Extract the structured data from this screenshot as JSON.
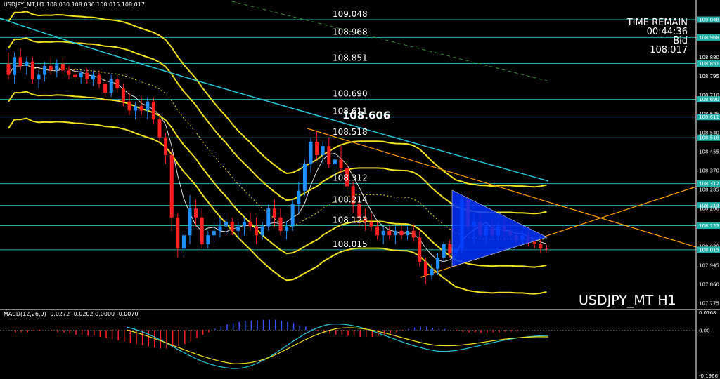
{
  "header": {
    "symbol_info": "USDJPY_MT,H1  108.030 108.036 108.015 108.017",
    "macd_info": "MACD(12,26,9) -0.0272 -0.0202 0.0000 -0.0070"
  },
  "time_remain": {
    "title": "TIME REMAIN",
    "time": "00:44:36",
    "bid_label": "Bid",
    "bid_value": "108.017"
  },
  "watermark": "USDJPY_MT H1",
  "colors": {
    "background": "#000000",
    "bull": "#1e90ff",
    "bear": "#ff2020",
    "level_line": "#20b2aa",
    "bollinger": "#f0e020",
    "trendline": "#ff9900",
    "ma_cyan": "#26c6da",
    "macd_hist_pos": "#3355ff",
    "macd_hist_neg": "#ff2020",
    "triangle_fill": "#0033ff"
  },
  "chart_data": {
    "type": "candlestick",
    "y_axis_ticks": [
      "109.048",
      "108.968",
      "108.880",
      "108.851",
      "108.795",
      "108.710",
      "108.690",
      "108.625",
      "108.611",
      "108.540",
      "108.518",
      "108.455",
      "108.370",
      "108.312",
      "108.285",
      "108.214",
      "108.200",
      "108.123",
      "108.030",
      "108.015",
      "107.945",
      "107.860",
      "107.775"
    ],
    "highlighted_ticks": [
      "109.048",
      "108.968",
      "108.851",
      "108.690",
      "108.611",
      "108.518",
      "108.312",
      "108.214",
      "108.123",
      "108.015"
    ],
    "levels": [
      {
        "label": "109.048",
        "value": 109.048
      },
      {
        "label": "108.968",
        "value": 108.968
      },
      {
        "label": "108.851",
        "value": 108.851
      },
      {
        "label": "108.690",
        "value": 108.69
      },
      {
        "label": "108.611",
        "value": 108.611
      },
      {
        "label": "108.518",
        "value": 108.518
      },
      {
        "label": "108.312",
        "value": 108.312
      },
      {
        "label": "108.214",
        "value": 108.214
      },
      {
        "label": "108.123",
        "value": 108.123
      },
      {
        "label": "108.015",
        "value": 108.015
      }
    ],
    "marked_price": {
      "label": "108.606",
      "value": 108.606
    },
    "price_range": [
      107.74,
      109.11
    ],
    "candles": [
      [
        108.85,
        108.9,
        108.78,
        108.8
      ],
      [
        108.8,
        108.9,
        108.76,
        108.88
      ],
      [
        108.88,
        108.92,
        108.82,
        108.84
      ],
      [
        108.84,
        108.88,
        108.8,
        108.86
      ],
      [
        108.86,
        108.88,
        108.76,
        108.78
      ],
      [
        108.78,
        108.82,
        108.74,
        108.8
      ],
      [
        108.8,
        108.86,
        108.77,
        108.84
      ],
      [
        108.84,
        108.88,
        108.8,
        108.82
      ],
      [
        108.82,
        108.87,
        108.79,
        108.85
      ],
      [
        108.85,
        108.88,
        108.8,
        108.82
      ],
      [
        108.82,
        108.84,
        108.78,
        108.8
      ],
      [
        108.8,
        108.83,
        108.77,
        108.79
      ],
      [
        108.79,
        108.82,
        108.76,
        108.81
      ],
      [
        108.81,
        108.83,
        108.76,
        108.78
      ],
      [
        108.78,
        108.82,
        108.75,
        108.8
      ],
      [
        108.8,
        108.82,
        108.74,
        108.76
      ],
      [
        108.76,
        108.78,
        108.7,
        108.72
      ],
      [
        108.72,
        108.8,
        108.7,
        108.78
      ],
      [
        108.78,
        108.8,
        108.72,
        108.74
      ],
      [
        108.74,
        108.76,
        108.66,
        108.68
      ],
      [
        108.68,
        108.72,
        108.62,
        108.64
      ],
      [
        108.64,
        108.68,
        108.6,
        108.66
      ],
      [
        108.66,
        108.7,
        108.62,
        108.64
      ],
      [
        108.64,
        108.7,
        108.6,
        108.68
      ],
      [
        108.68,
        108.7,
        108.58,
        108.6
      ],
      [
        108.6,
        108.62,
        108.5,
        108.52
      ],
      [
        108.52,
        108.54,
        108.4,
        108.44
      ],
      [
        108.44,
        108.46,
        108.1,
        108.16
      ],
      [
        108.16,
        108.18,
        107.98,
        108.02
      ],
      [
        108.02,
        108.1,
        107.98,
        108.08
      ],
      [
        108.08,
        108.26,
        108.04,
        108.2
      ],
      [
        108.2,
        108.24,
        108.12,
        108.16
      ],
      [
        108.16,
        108.2,
        108.02,
        108.04
      ],
      [
        108.04,
        108.1,
        108.02,
        108.08
      ],
      [
        108.08,
        108.14,
        108.05,
        108.1
      ],
      [
        108.1,
        108.16,
        108.07,
        108.12
      ],
      [
        108.12,
        108.18,
        108.08,
        108.14
      ],
      [
        108.14,
        108.16,
        108.08,
        108.1
      ],
      [
        108.1,
        108.14,
        108.06,
        108.12
      ],
      [
        108.12,
        108.16,
        108.08,
        108.14
      ],
      [
        108.14,
        108.18,
        108.1,
        108.12
      ],
      [
        108.12,
        108.16,
        108.04,
        108.08
      ],
      [
        108.08,
        108.14,
        108.06,
        108.12
      ],
      [
        108.12,
        108.22,
        108.1,
        108.2
      ],
      [
        108.2,
        108.24,
        108.12,
        108.16
      ],
      [
        108.16,
        108.2,
        108.08,
        108.1
      ],
      [
        108.1,
        108.14,
        108.06,
        108.12
      ],
      [
        108.12,
        108.24,
        108.1,
        108.22
      ],
      [
        108.22,
        108.32,
        108.18,
        108.28
      ],
      [
        108.28,
        108.42,
        108.26,
        108.4
      ],
      [
        108.4,
        108.52,
        108.36,
        108.5
      ],
      [
        108.5,
        108.55,
        108.42,
        108.44
      ],
      [
        108.44,
        108.5,
        108.4,
        108.48
      ],
      [
        108.48,
        108.52,
        108.38,
        108.4
      ],
      [
        108.4,
        108.44,
        108.34,
        108.42
      ],
      [
        108.42,
        108.48,
        108.36,
        108.38
      ],
      [
        108.38,
        108.42,
        108.28,
        108.3
      ],
      [
        108.3,
        108.32,
        108.18,
        108.22
      ],
      [
        108.22,
        108.24,
        108.12,
        108.16
      ],
      [
        108.16,
        108.2,
        108.1,
        108.14
      ],
      [
        108.14,
        108.18,
        108.1,
        108.12
      ],
      [
        108.12,
        108.14,
        108.06,
        108.08
      ],
      [
        108.08,
        108.12,
        108.04,
        108.1
      ],
      [
        108.1,
        108.12,
        108.06,
        108.08
      ],
      [
        108.08,
        108.12,
        108.04,
        108.1
      ],
      [
        108.1,
        108.13,
        108.06,
        108.08
      ],
      [
        108.08,
        108.12,
        108.06,
        108.1
      ],
      [
        108.1,
        108.13,
        108.05,
        108.07
      ],
      [
        108.07,
        108.1,
        107.94,
        107.96
      ],
      [
        107.96,
        107.98,
        107.86,
        107.9
      ],
      [
        107.9,
        107.95,
        107.88,
        107.93
      ],
      [
        107.93,
        108.0,
        107.9,
        107.98
      ],
      [
        107.98,
        108.05,
        107.96,
        108.04
      ],
      [
        108.04,
        108.06,
        107.98,
        108.0
      ],
      [
        108.0,
        108.04,
        107.98,
        108.02
      ],
      [
        108.02,
        108.26,
        108.0,
        108.24
      ],
      [
        108.24,
        108.26,
        108.1,
        108.12
      ],
      [
        108.12,
        108.18,
        108.04,
        108.14
      ],
      [
        108.14,
        108.18,
        108.06,
        108.08
      ],
      [
        108.08,
        108.14,
        108.04,
        108.12
      ],
      [
        108.12,
        108.15,
        108.06,
        108.08
      ],
      [
        108.08,
        108.14,
        108.05,
        108.12
      ],
      [
        108.12,
        108.16,
        108.06,
        108.1
      ],
      [
        108.1,
        108.14,
        108.06,
        108.08
      ],
      [
        108.08,
        108.12,
        108.04,
        108.06
      ],
      [
        108.06,
        108.1,
        108.04,
        108.08
      ],
      [
        108.08,
        108.1,
        108.03,
        108.05
      ],
      [
        108.05,
        108.08,
        108.02,
        108.04
      ],
      [
        108.04,
        108.06,
        108.0,
        108.02
      ],
      [
        108.02,
        108.036,
        108.01,
        108.017
      ]
    ],
    "macd_ticks": [
      "0.0768",
      "0.00",
      "-0.1966"
    ],
    "macd_range": [
      -0.1966,
      0.0768
    ],
    "macd_histogram": [
      -0.01,
      -0.01,
      -0.01,
      -0.005,
      -0.005,
      0,
      -0.005,
      -0.01,
      -0.01,
      -0.015,
      -0.02,
      -0.02,
      -0.025,
      -0.025,
      -0.03,
      -0.035,
      -0.04,
      -0.045,
      -0.05,
      -0.055,
      -0.06,
      -0.065,
      -0.07,
      -0.075,
      -0.08,
      -0.08,
      -0.075,
      -0.07,
      -0.06,
      -0.05,
      -0.035,
      -0.02,
      -0.01,
      0.005,
      0.015,
      0.025,
      0.03,
      0.035,
      0.04,
      0.04,
      0.042,
      0.045,
      0.045,
      0.045,
      0.04,
      0.035,
      0.03,
      0.02,
      0.015,
      0.005,
      -0.005,
      -0.01,
      -0.015,
      -0.02,
      -0.02,
      -0.025,
      -0.025,
      -0.03,
      -0.03,
      -0.03,
      -0.025,
      -0.02,
      -0.015,
      -0.01,
      -0.005,
      0.005,
      0.01,
      0.015,
      0.015,
      0.01,
      0.005,
      0.005,
      0,
      -0.005,
      -0.008,
      -0.01,
      -0.01,
      -0.012,
      -0.012,
      -0.01,
      -0.01,
      -0.008,
      -0.007,
      -0.007
    ]
  }
}
